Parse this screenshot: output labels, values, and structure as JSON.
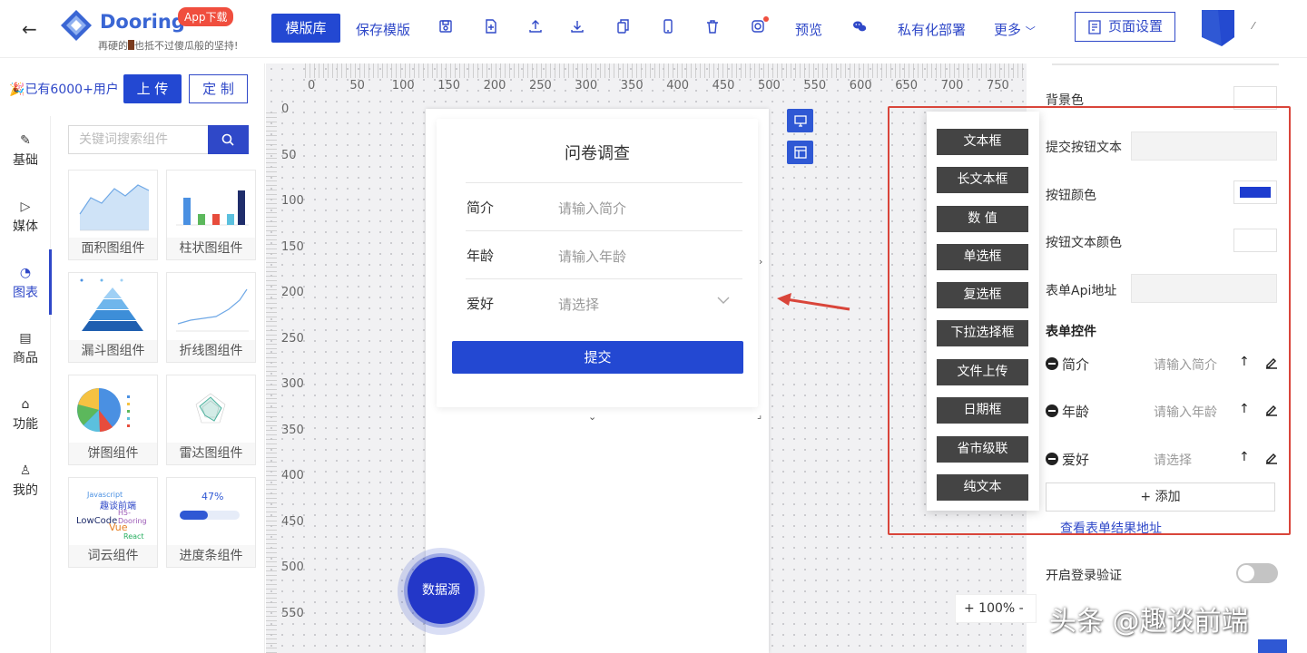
{
  "header": {
    "back_icon": "arrow-left-icon",
    "logo_name": "Dooring",
    "app_badge": "App下载",
    "slogan_pre": "再硬的",
    "slogan_post": "也抵不过傻瓜般的坚持!",
    "template_library": "模版库",
    "save_template": "保存模版",
    "preview": "预览",
    "private_deploy": "私有化部署",
    "more": "更多",
    "page_settings": "页面设置",
    "caret": "⁄",
    "brand_color": "#2348d2",
    "badge_color": "#f04e3e"
  },
  "left": {
    "users": "已有6000+用户",
    "upload": "上 传",
    "custom": "定 制",
    "search_placeholder": "关键词搜索组件",
    "categories": [
      {
        "icon": "pen-icon",
        "glyph": "✎",
        "label": "基础"
      },
      {
        "icon": "play-icon",
        "glyph": "▷",
        "label": "媒体"
      },
      {
        "icon": "pie-chart-icon",
        "glyph": "◔",
        "label": "图表"
      },
      {
        "icon": "shop-icon",
        "glyph": "▤",
        "label": "商品"
      },
      {
        "icon": "function-icon",
        "glyph": "⌂",
        "label": "功能"
      },
      {
        "icon": "user-icon",
        "glyph": "♙",
        "label": "我的"
      }
    ],
    "components": [
      "面积图组件",
      "柱状图组件",
      "漏斗图组件",
      "折线图组件",
      "饼图组件",
      "雷达图组件",
      "词云组件",
      "进度条组件"
    ],
    "progress_value": "47%",
    "progress_fraction": 0.47,
    "word_cloud_words": [
      "Javascript",
      "趣谈前端",
      "H5-Dooring",
      "LowCode",
      "Vue",
      "React"
    ]
  },
  "canvas": {
    "ruler_x": [
      "0",
      "50",
      "100",
      "150",
      "200",
      "250",
      "300",
      "350",
      "400",
      "450",
      "500",
      "550",
      "600",
      "650",
      "700",
      "750"
    ],
    "ruler_y": [
      "0",
      "50",
      "100",
      "150",
      "200",
      "250",
      "300",
      "350",
      "400",
      "450",
      "500",
      "550"
    ],
    "form": {
      "title": "问卷调查",
      "rows": [
        {
          "label": "简介",
          "placeholder": "请输入简介"
        },
        {
          "label": "年龄",
          "placeholder": "请输入年龄"
        },
        {
          "label": "爱好",
          "placeholder": "请选择"
        }
      ],
      "submit": "提交"
    },
    "datasource": "数据源",
    "zoom": "+  100%  -"
  },
  "popup": {
    "items": [
      "文本框",
      "长文本框",
      "数 值",
      "单选框",
      "复选框",
      "下拉选择框",
      "文件上传",
      "日期框",
      "省市级联",
      "纯文本"
    ]
  },
  "right": {
    "background_color": "背景色",
    "submit_text": "提交按钮文本",
    "button_color": "按钮颜色",
    "button_color_value": "#1d3ccf",
    "button_text_color": "按钮文本颜色",
    "api_address": "表单Api地址",
    "form_controls": "表单控件",
    "controls": [
      {
        "name": "简介",
        "placeholder": "请输入简介"
      },
      {
        "name": "年龄",
        "placeholder": "请输入年龄"
      },
      {
        "name": "爱好",
        "placeholder": "请选择"
      }
    ],
    "add": "+  添加",
    "view_results": "查看表单结果地址",
    "login_verify": "开启登录验证",
    "login_verify_enabled": false
  },
  "watermark": "头条 @趣谈前端",
  "annotation_color": "#d9453a"
}
